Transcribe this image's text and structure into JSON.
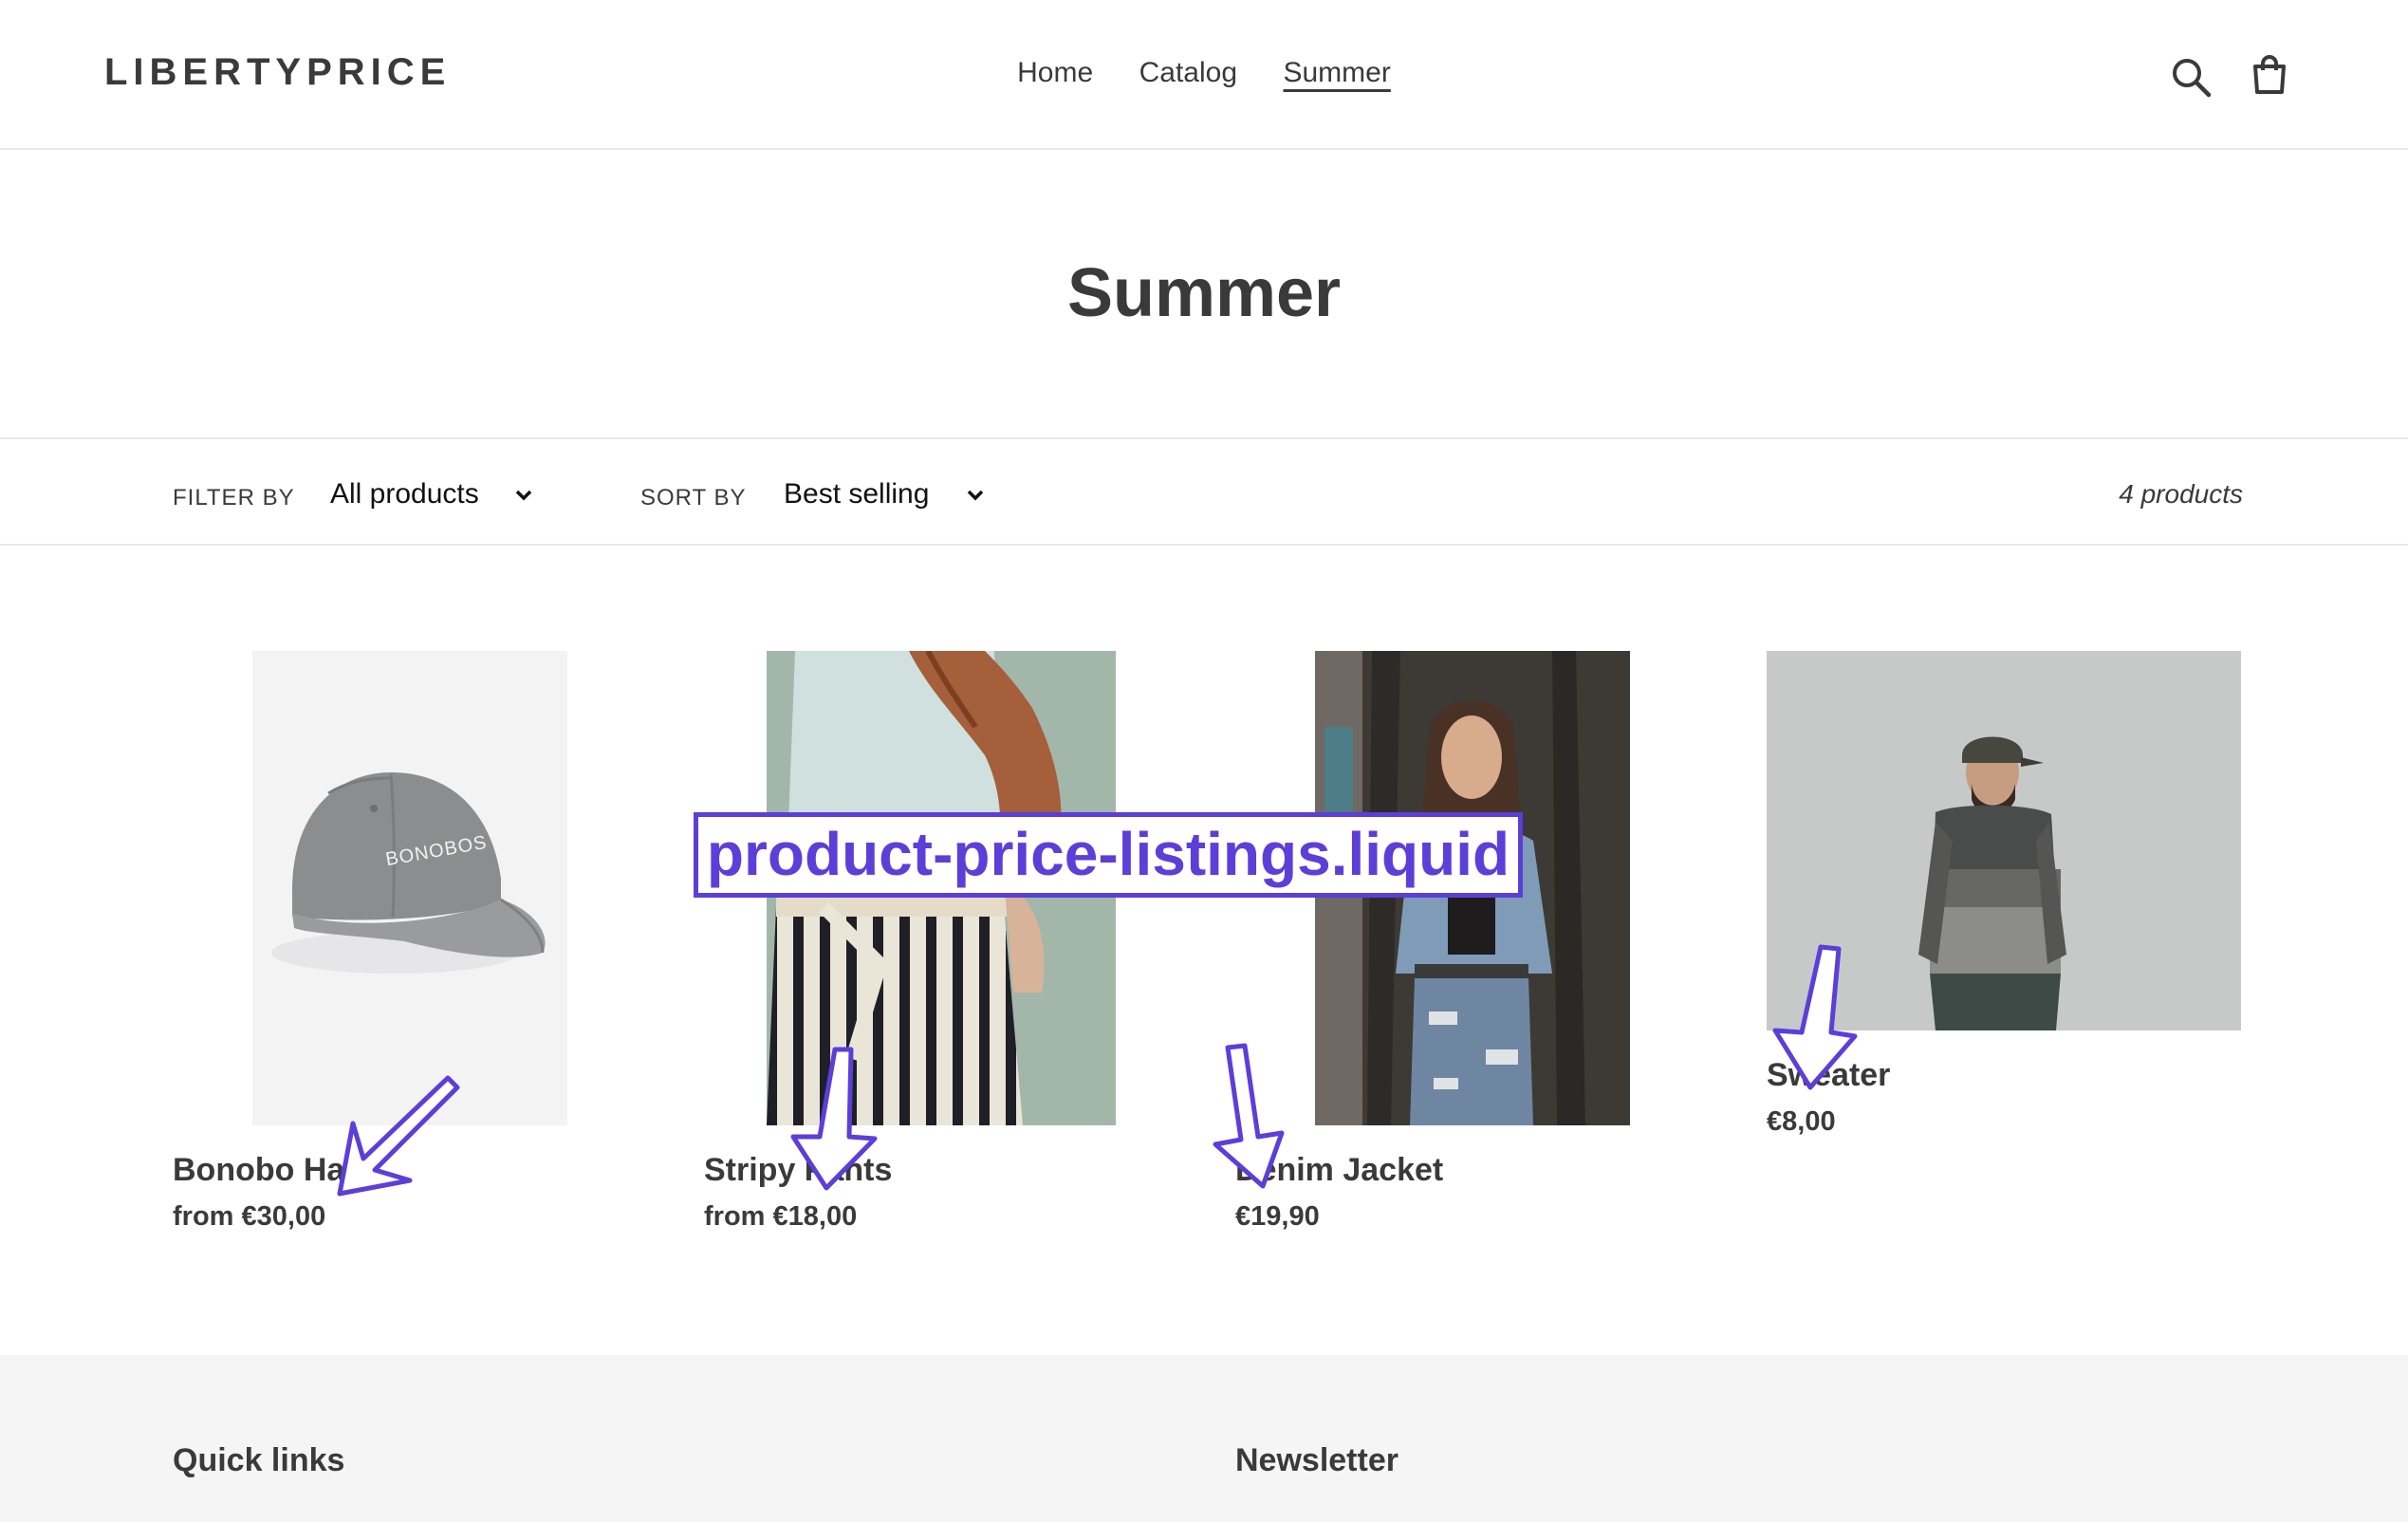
{
  "header": {
    "logo": "LIBERTYPRICE",
    "nav": [
      {
        "label": "Home",
        "active": false
      },
      {
        "label": "Catalog",
        "active": false
      },
      {
        "label": "Summer",
        "active": true
      }
    ],
    "icons": [
      "search-icon",
      "cart-icon"
    ]
  },
  "collection": {
    "title": "Summer",
    "filter_label": "FILTER BY",
    "filter_value": "All products",
    "sort_label": "SORT BY",
    "sort_value": "Best selling",
    "count": "4 products"
  },
  "products": [
    {
      "title": "Bonobo Hat",
      "price": "from €30,00",
      "image_text": "BONOBOS"
    },
    {
      "title": "Stripy Pants",
      "price": "from €18,00"
    },
    {
      "title": "Denim Jacket",
      "price": "€19,90"
    },
    {
      "title": "Sweater",
      "price": "€8,00"
    }
  ],
  "annotation": {
    "label": "product-price-listings.liquid",
    "color": "#5b3fd8"
  },
  "footer": {
    "quick_links": "Quick links",
    "newsletter": "Newsletter"
  }
}
